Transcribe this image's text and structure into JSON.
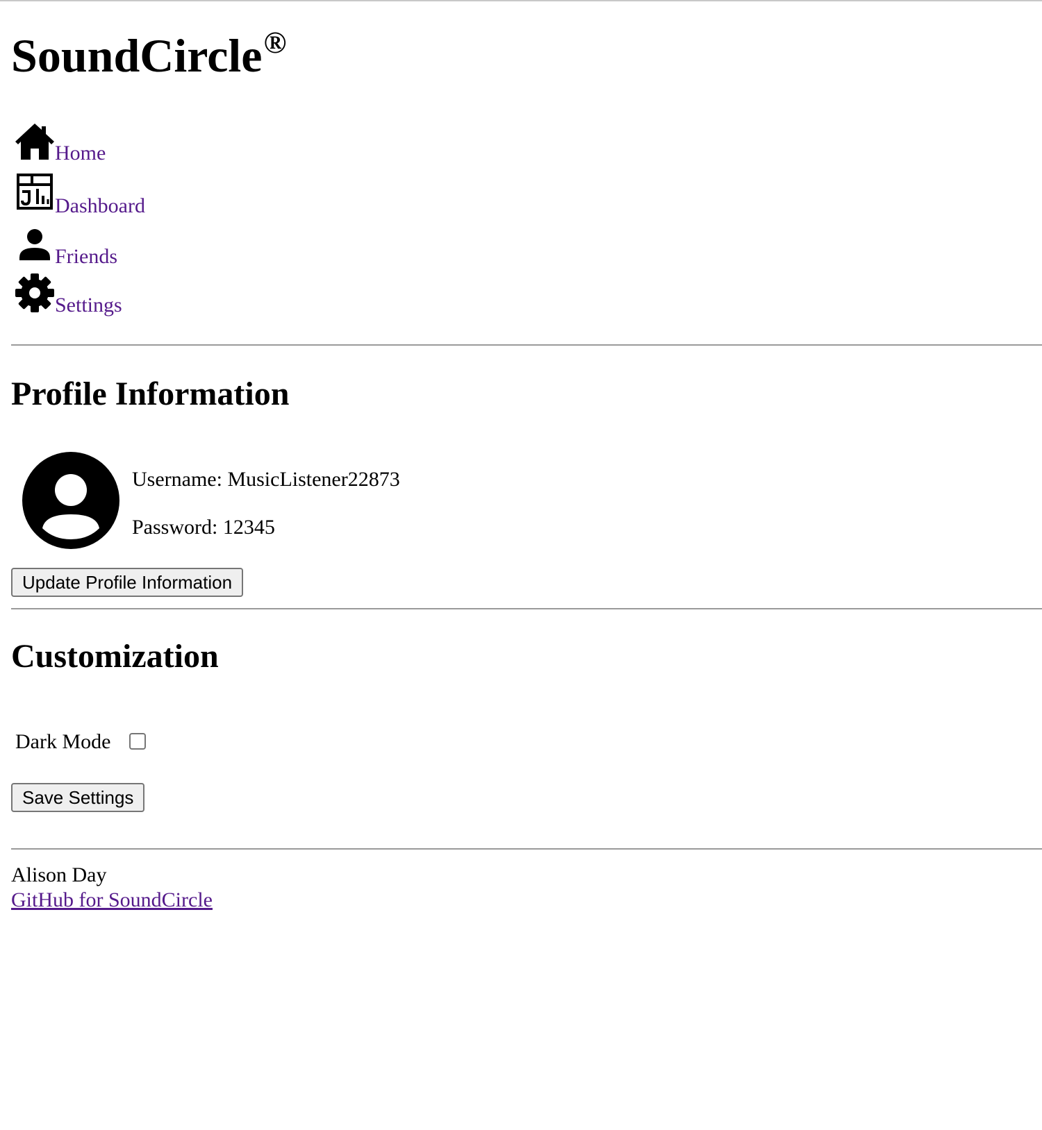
{
  "header": {
    "title": "SoundCircle",
    "trademark": "®"
  },
  "nav": {
    "items": [
      {
        "label": "Home",
        "icon": "home-icon"
      },
      {
        "label": " Dashboard",
        "icon": "dashboard-icon"
      },
      {
        "label": " Friends",
        "icon": "person-icon"
      },
      {
        "label": " Settings",
        "icon": "gear-icon"
      }
    ],
    "link_color": "#551a8b"
  },
  "profile": {
    "heading": "Profile Information",
    "avatar_icon": "account-circle-icon",
    "username_text": "Username: MusicListener22873",
    "password_text": "Password: 12345",
    "update_button_label": "Update Profile Information"
  },
  "customization": {
    "heading": "Customization",
    "dark_mode_label": "Dark Mode",
    "dark_mode_checked": false,
    "save_button_label": "Save Settings"
  },
  "footer": {
    "author": "Alison Day",
    "github_link_text": "GitHub for SoundCircle"
  }
}
